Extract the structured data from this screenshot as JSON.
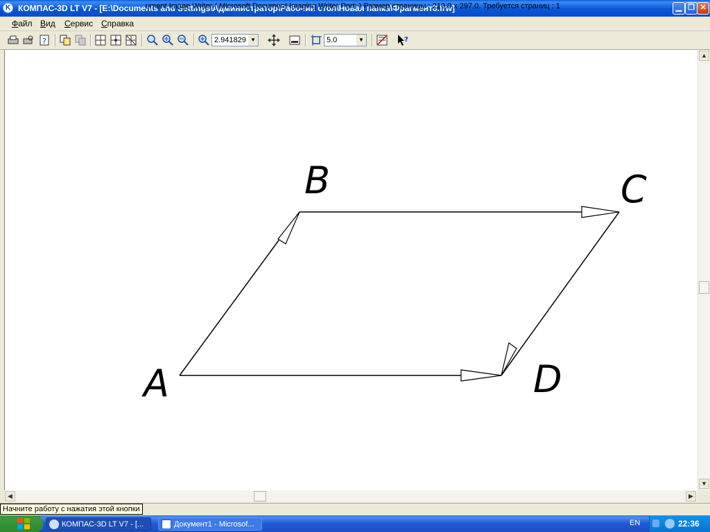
{
  "window": {
    "title": "КОМПАС-3D LT V7 - [E:\\Documents and Settings\\Администратор\\Рабочий стол\\Новая папка\\Фрагмент8.frw]",
    "icon_letter": "K"
  },
  "menu": {
    "items": [
      {
        "label": "Файл"
      },
      {
        "label": "Вид"
      },
      {
        "label": "Сервис"
      },
      {
        "label": "Справка"
      }
    ]
  },
  "toolbar": {
    "zoom_value": "2.941829",
    "step_value": "5.0",
    "icons": [
      "printer-icon",
      "print-preview-icon",
      "help-icon",
      "copy-icon",
      "paste-icon",
      "grid-icon",
      "grid-snap-icon",
      "grid-window-icon",
      "zoom-icon",
      "zoom-in-icon",
      "zoom-out-icon",
      "zoom-scale-icon",
      "pan-icon",
      "window-icon",
      "step-cursor-icon",
      "library-icon",
      "context-help-icon"
    ]
  },
  "drawing": {
    "points": {
      "A": "A",
      "B": "B",
      "C": "C",
      "D": "D"
    }
  },
  "status": {
    "tooltip": "Начните работу с нажатия этой кнопки",
    "text": "ument Image Writer ( Microsoft Document Imaging Writer Port: )  Размер страницы : 210.0 x 297.0.  Требуется страниц : 1"
  },
  "taskbar": {
    "tasks": [
      {
        "label": "КОМПАС-3D LT V7 - [..."
      },
      {
        "label": "Документ1 - Microsof..."
      }
    ],
    "language": "EN",
    "clock": "22:36"
  },
  "colors": {
    "titlebar": "#0a5fd8",
    "canvas": "#ffffff",
    "line": "#000000"
  }
}
